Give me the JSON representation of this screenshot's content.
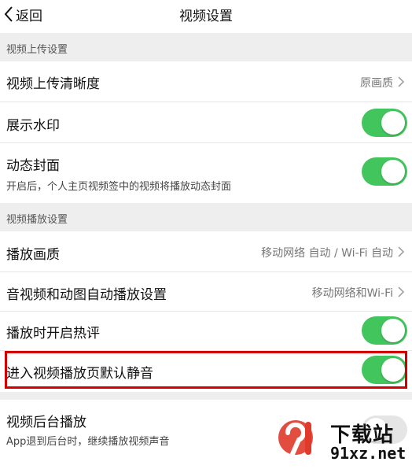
{
  "nav": {
    "back_label": "返回",
    "title": "视频设置"
  },
  "sections": {
    "upload": "视频上传设置",
    "playback": "视频播放设置"
  },
  "rows": {
    "upload_quality": {
      "label": "视频上传清晰度",
      "value": "原画质"
    },
    "watermark": {
      "label": "展示水印",
      "on": true
    },
    "dynamic_cover": {
      "label": "动态封面",
      "sub": "开启后，个人主页视频签中的视频将播放动态封面",
      "on": true
    },
    "play_quality": {
      "label": "播放画质",
      "value": "移动网络 自动 / Wi-Fi 自动"
    },
    "autoplay": {
      "label": "音视频和动图自动播放设置",
      "value": "移动网络和Wi-Fi"
    },
    "hot_comments": {
      "label": "播放时开启热评",
      "on": true
    },
    "mute_default": {
      "label": "进入视频播放页默认静音",
      "on": true
    },
    "background_play": {
      "label": "视频后台播放",
      "sub": "App退到后台时，继续播放视频声音",
      "on": false
    }
  },
  "watermark_logo": {
    "line1": "下载站",
    "line2": "91xz.net"
  },
  "colors": {
    "toggle_on": "#43c55d",
    "highlight": "#d40000"
  }
}
